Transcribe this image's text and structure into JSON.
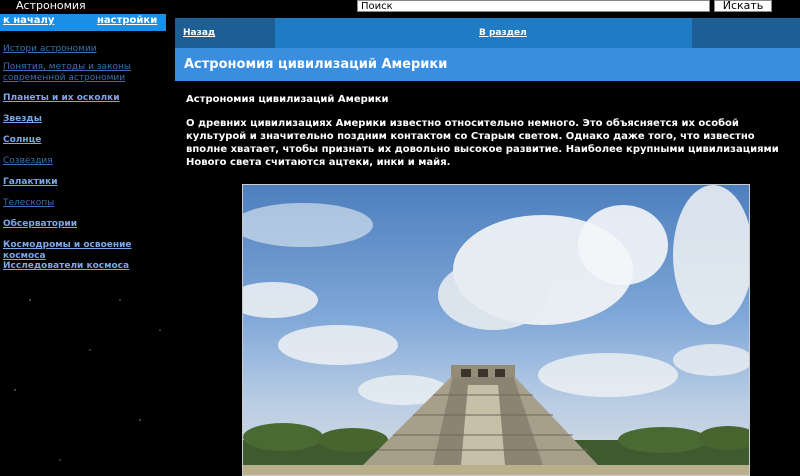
{
  "header": {
    "site_title": "Астрономия",
    "search_placeholder": "Поиск",
    "search_button": "Искать"
  },
  "sidebar": {
    "home_link": "к началу",
    "settings_link": "настройки",
    "items": [
      {
        "label": "Истори астрономии"
      },
      {
        "label": "Понятия, методы и законы современной астрономии"
      },
      {
        "label": "Планеты и их осколки"
      },
      {
        "label": "Звезды"
      },
      {
        "label": "Солнце"
      },
      {
        "label": "Созвездия"
      },
      {
        "label": "Галактики"
      },
      {
        "label": "Телескопы"
      },
      {
        "label": "Обсерватории"
      },
      {
        "label": "Космодромы и освоение космоса"
      },
      {
        "label": "Исследователи космоса"
      }
    ]
  },
  "main": {
    "tabs": {
      "back": "Назад",
      "section": "В раздел"
    },
    "title": "Астрономия цивилизаций Америки",
    "subtitle": "Астрономия цивилизаций Америки",
    "paragraph": "О древних цивилизациях Америки известно относительно немного. Это объясняется их особой культурой и значительно поздним контактом со Старым светом. Однако даже того, что известно вполне хватает, чтобы признать их довольно высокое развитие. Наиболее крупными цивилизациями Нового света считаются ацтеки, инки и майя."
  },
  "colors": {
    "accent": "#1b8fe6",
    "title_bar": "#3a8ee0",
    "tab_bar": "#1d5f95",
    "link": "#7aa8e8"
  }
}
